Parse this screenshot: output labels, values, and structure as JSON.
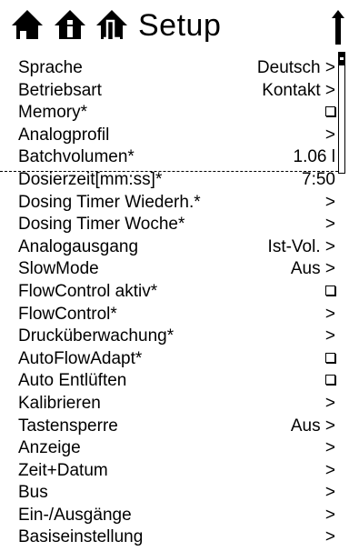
{
  "header": {
    "title": "Setup",
    "icons": [
      "home-icon",
      "info-icon",
      "graph-icon",
      "up-arrow-icon"
    ]
  },
  "menu": {
    "items": [
      {
        "label": "Sprache",
        "value": "Deutsch >"
      },
      {
        "label": "Betriebsart",
        "value": "Kontakt >"
      },
      {
        "label": "Memory*",
        "value": "",
        "checkbox": true
      },
      {
        "label": "Analogprofil",
        "value": ">"
      },
      {
        "label": "Batchvolumen*",
        "value": "1.06 l"
      },
      {
        "label": "Dosierzeit[mm:ss]*",
        "value": "7:50"
      },
      {
        "label": "Dosing Timer Wiederh.*",
        "value": ">"
      },
      {
        "label": "Dosing Timer Woche*",
        "value": ">"
      },
      {
        "label": "Analogausgang",
        "value": "Ist-Vol. >"
      },
      {
        "label": "SlowMode",
        "value": "Aus >"
      },
      {
        "label": "FlowControl aktiv*",
        "value": "",
        "checkbox": true
      },
      {
        "label": "FlowControl*",
        "value": ">"
      },
      {
        "label": "Drucküberwachung*",
        "value": ">"
      },
      {
        "label": "AutoFlowAdapt*",
        "value": "",
        "checkbox": true
      },
      {
        "label": "Auto Entlüften",
        "value": "",
        "checkbox": true
      },
      {
        "label": "Kalibrieren",
        "value": ">"
      },
      {
        "label": "Tastensperre",
        "value": "Aus >"
      },
      {
        "label": "Anzeige",
        "value": ">"
      },
      {
        "label": "Zeit+Datum",
        "value": ">"
      },
      {
        "label": "Bus",
        "value": ">"
      },
      {
        "label": "Ein-/Ausgänge",
        "value": ">"
      },
      {
        "label": "Basiseinstellung",
        "value": ">"
      }
    ]
  },
  "scrollbar": {
    "position": 0.0
  }
}
